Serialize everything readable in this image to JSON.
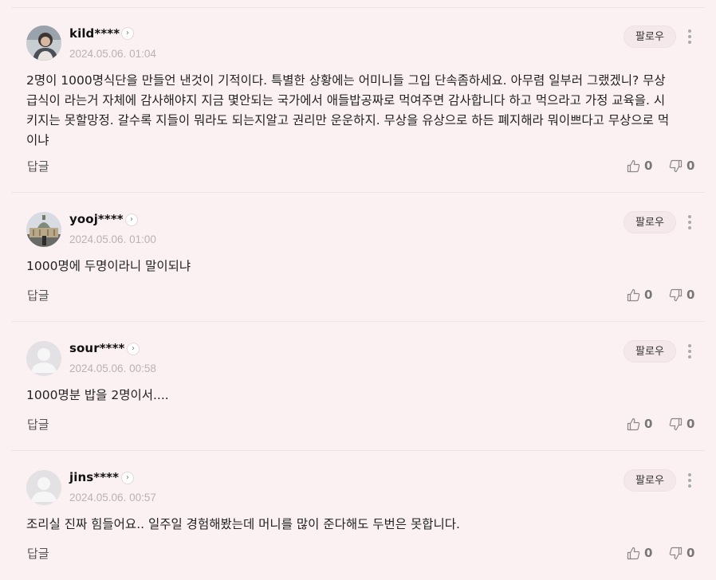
{
  "comments": [
    {
      "nickname": "kild****",
      "date": "2024.05.06. 01:04",
      "follow_label": "팔로우",
      "text": "2명이 1000명식단을 만들언 낸것이 기적이다. 특별한 상황에는 어미니들 그입 단속좀하세요. 아무렴 일부러 그랬겠니? 무상급식이 라는거 자체에 감사해야지 지금 몇안되는 국가에서 애들밥공짜로 먹여주면 감사합니다 하고 먹으라고 가정 교육을. 시키지는 못할망정. 갈수록 지들이 뭐라도 되는지알고 권리만 운운하지. 무상을 유상으로 하든 폐지해라 뭐이쁘다고 무상으로 먹이냐",
      "reply_label": "답글",
      "likes": "0",
      "dislikes": "0",
      "avatar": "person-photo"
    },
    {
      "nickname": "yooj****",
      "date": "2024.05.06. 01:00",
      "follow_label": "팔로우",
      "text": "1000명에 두명이라니 말이되냐",
      "reply_label": "답글",
      "likes": "0",
      "dislikes": "0",
      "avatar": "building-photo"
    },
    {
      "nickname": "sour****",
      "date": "2024.05.06. 00:58",
      "follow_label": "팔로우",
      "text": "1000명분 밥을 2명이서....",
      "reply_label": "답글",
      "likes": "0",
      "dislikes": "0",
      "avatar": "default-user"
    },
    {
      "nickname": "jins****",
      "date": "2024.05.06. 00:57",
      "follow_label": "팔로우",
      "text": "조리실 진짜 힘들어요.. 일주일 경험해봤는데 머니를 많이 준다해도 두번은 못합니다.",
      "reply_label": "답글",
      "likes": "0",
      "dislikes": "0",
      "avatar": "default-user"
    }
  ],
  "colors": {
    "background": "#fcf1f2",
    "follow_bg": "#f5e8ea",
    "muted": "#b9b1b3"
  }
}
